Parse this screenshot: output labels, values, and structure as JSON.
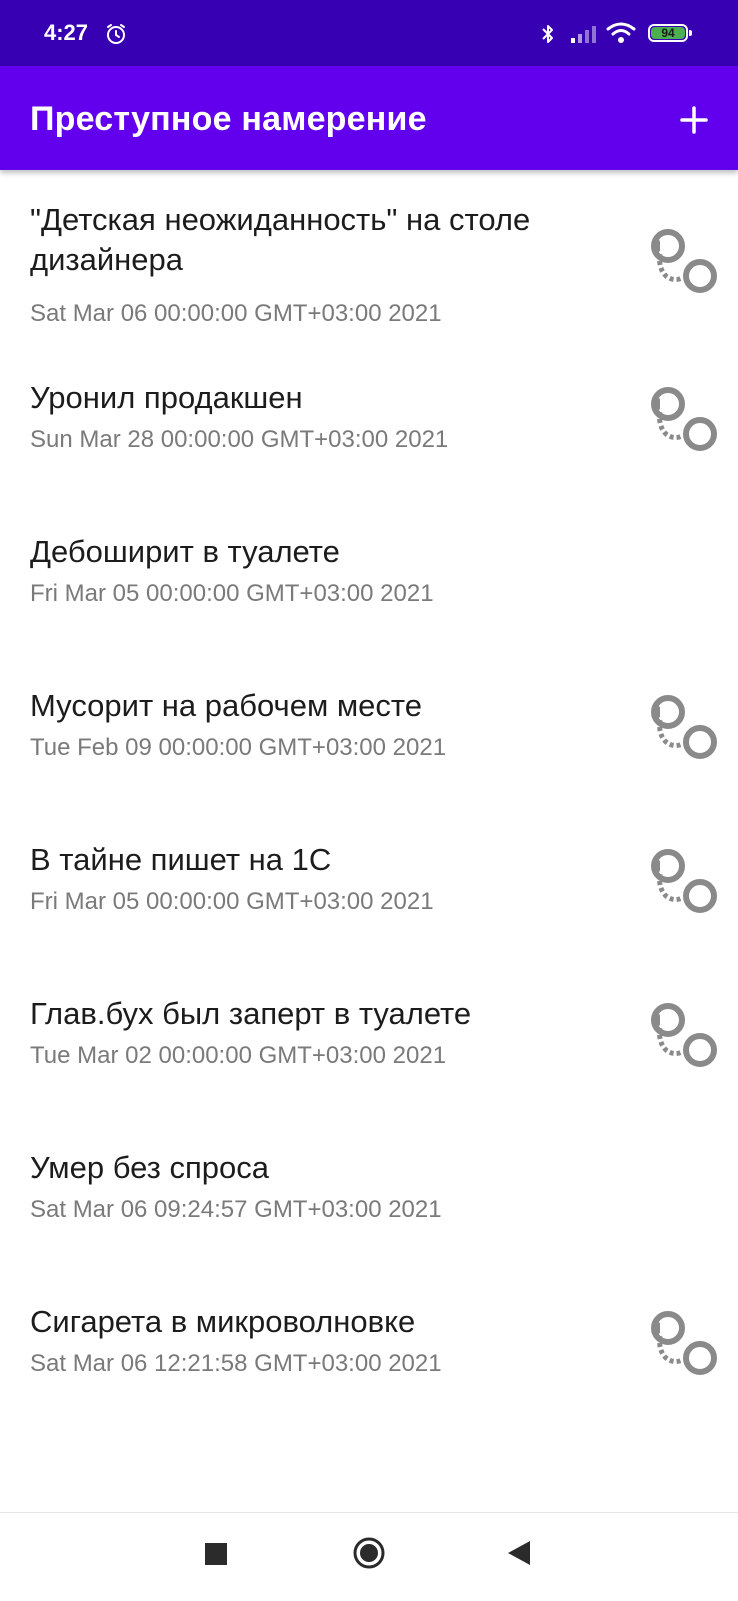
{
  "status_bar": {
    "time": "4:27",
    "battery": "94",
    "icons": [
      "alarm-icon",
      "bluetooth-icon",
      "signal-icon",
      "wifi-icon",
      "battery-icon"
    ]
  },
  "app_bar": {
    "title": "Преступное намерение",
    "add_icon": "plus-icon"
  },
  "crimes": [
    {
      "title": "\"Детская неожиданность\" на столе дизайнера",
      "date": "Sat Mar 06 00:00:00 GMT+03:00 2021",
      "solved": true
    },
    {
      "title": "Уронил продакшен",
      "date": "Sun Mar 28 00:00:00 GMT+03:00 2021",
      "solved": true
    },
    {
      "title": "Дебоширит в туалете",
      "date": "Fri Mar 05 00:00:00 GMT+03:00 2021",
      "solved": false
    },
    {
      "title": "Мусорит на рабочем месте",
      "date": "Tue Feb 09 00:00:00 GMT+03:00 2021",
      "solved": true
    },
    {
      "title": "В тайне пишет на 1С",
      "date": "Fri Mar 05 00:00:00 GMT+03:00 2021",
      "solved": true
    },
    {
      "title": "Глав.бух был заперт в туалете",
      "date": "Tue Mar 02 00:00:00 GMT+03:00 2021",
      "solved": true
    },
    {
      "title": "Умер без спроса",
      "date": "Sat Mar 06 09:24:57 GMT+03:00 2021",
      "solved": false
    },
    {
      "title": "Сигарета в микроволновке",
      "date": "Sat Mar 06 12:21:58 GMT+03:00 2021",
      "solved": true
    }
  ],
  "solved_icon": "handcuffs-icon",
  "nav_bar": {
    "icons": [
      "recents-icon",
      "home-icon",
      "back-icon"
    ]
  },
  "colors": {
    "status_bar": "#3700b3",
    "app_bar": "#6200ee",
    "icon_gray": "#8a8a8a"
  }
}
